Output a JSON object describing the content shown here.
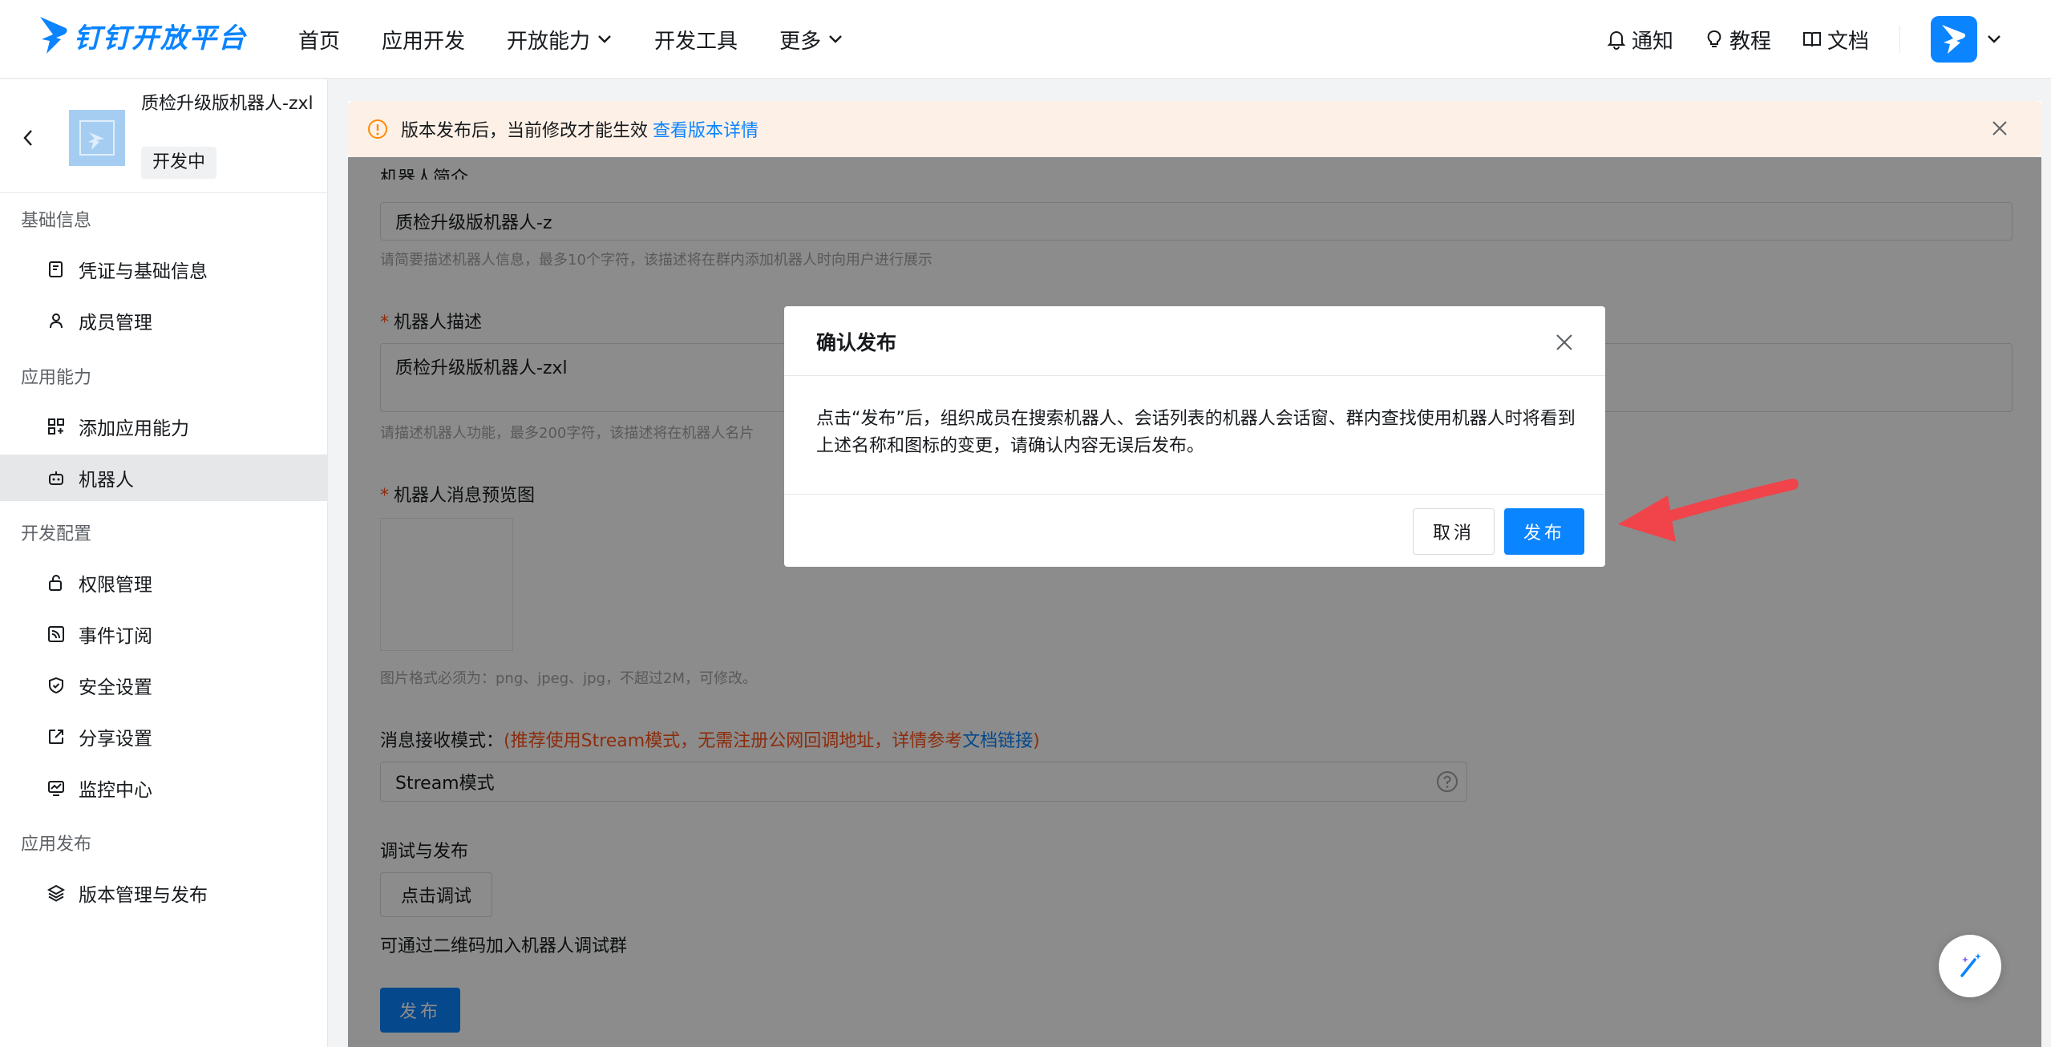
{
  "header": {
    "logo_text": "钉钉开放平台",
    "nav": [
      "首页",
      "应用开发",
      "开放能力",
      "开发工具",
      "更多"
    ],
    "right": {
      "notice": "通知",
      "tutorial": "教程",
      "docs": "文档"
    }
  },
  "sidebar": {
    "app_name": "质检升级版机器人-zxl",
    "app_status": "开发中",
    "groups": {
      "basic": "基础信息",
      "capability": "应用能力",
      "dev_config": "开发配置",
      "publish": "应用发布"
    },
    "items": {
      "credentials": "凭证与基础信息",
      "members": "成员管理",
      "add_capability": "添加应用能力",
      "robot": "机器人",
      "permissions": "权限管理",
      "events": "事件订阅",
      "security": "安全设置",
      "share": "分享设置",
      "monitor": "监控中心",
      "versions": "版本管理与发布"
    }
  },
  "banner": {
    "text": "版本发布后，当前修改才能生效",
    "link": "查看版本详情"
  },
  "form": {
    "intro_label": "机器人简介",
    "intro_value": "质检升级版机器人-z",
    "intro_hint": "请简要描述机器人信息，最多10个字符，该描述将在群内添加机器人时向用户进行展示",
    "desc_label": "机器人描述",
    "desc_value": "质检升级版机器人-zxl",
    "desc_hint": "请描述机器人功能，最多200字符，该描述将在机器人名片",
    "preview_label": "机器人消息预览图",
    "image_hint": "图片格式必须为：png、jpeg、jpg，不超过2M，可修改。",
    "mode_label": "消息接收模式：",
    "mode_warn_open": "(推荐使用Stream模式，无需注册公网回调地址，详情参考",
    "mode_link": "文档链接",
    "mode_warn_close": ")",
    "mode_value": "Stream模式",
    "debug_label": "调试与发布",
    "debug_button": "点击调试",
    "debug_hint": "可通过二维码加入机器人调试群",
    "publish_button": "发布"
  },
  "modal": {
    "title": "确认发布",
    "body": "点击“发布”后，组织成员在搜索机器人、会话列表的机器人会话窗、群内查找使用机器人时将看到上述名称和图标的变更，请确认内容无误后发布。",
    "cancel": "取消",
    "confirm": "发布"
  },
  "colors": {
    "primary": "#0a84ff",
    "warning": "#ff5219",
    "annotation_arrow": "#f0434a"
  }
}
